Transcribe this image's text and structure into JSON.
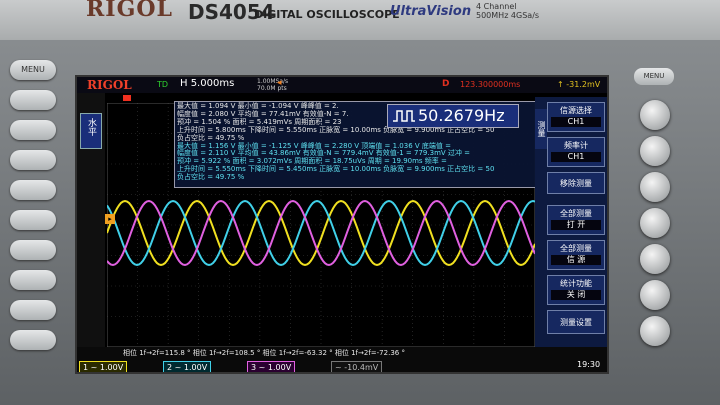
{
  "brand": "RIGOL",
  "model": "DS4054",
  "subtitle": "DIGITAL OSCILLOSCOPE",
  "logo_text": "UltraVision",
  "spec_line1": "4 Channel",
  "spec_line2": "500MHz 4GSa/s",
  "left_button": "MENU",
  "right_button": "MENU",
  "screen": {
    "logo": "RIGOL",
    "status": "TD",
    "timebase": "H  5.000ms",
    "sample_rate": "1.00MSa/s",
    "mem_depth": "70.0M pts",
    "trigger_icon": "trigger-icon",
    "delay_label": "D",
    "delay_value": "123.300000ms",
    "trigger_level": "-31.2mV",
    "h_button": "水平",
    "freq_value": "50.2679Hz",
    "phase_line": "相位 1f→2f=115.8 °     相位 1f→2f=108.5 °     相位 1f→2f=-63.32 °     相位 1f→2f=-72.36 °",
    "ch1": "~ 1.00V",
    "ch2": "~ 1.00V",
    "ch3": "~ 1.00V",
    "ch4": "~ -10.4mV",
    "clock": "19:30"
  },
  "measurements": {
    "rows": [
      "最大值 = 1.094 V    最小值 = -1.094 V    峰峰值 = 2.",
      "幅度值 = 2.080 V    平均值 = 77.41mV    有效值-N = 7.",
      "预冲  = 1.504 %     面积   = 5.419mVs   周期面积 = 23",
      "上升时间 = 5.800ms   下降时间 = 5.550ms   正脉宽 = 10.00ms   负脉宽 = 9.900ms   正占空比 = 50",
      "负占空比 = 49.75 %",
      "最大值 = 1.156 V    最小值 = -1.125 V    峰峰值 = 2.280 V    顶端值 = 1.036 V    底端值 = ",
      "幅度值 = 2.110 V    平均值 = 43.86mV    有效值-N = 779.4mV    有效值-1 = 779.3mV    过冲  = ",
      "预冲  = 5.922 %     面积   = 3.072mVs   周期面积 = 18.75uVs   周期  = 19.90ms    频率   = ",
      "上升时间 = 5.550ms   下降时间 = 5.450ms   正脉宽 = 10.00ms   负脉宽 = 9.900ms   正占空比 = 50",
      "负占空比 = 49.75 %"
    ]
  },
  "menu": {
    "side_tab": "测量",
    "items": [
      {
        "title": "信源选择",
        "value": "CH1"
      },
      {
        "title": "频率计",
        "value": "CH1"
      },
      {
        "title": "移除测量",
        "value": ""
      },
      {
        "title": "全部测量",
        "value": "打 开"
      },
      {
        "title": "全部测量",
        "value": "信 源"
      },
      {
        "title": "统计功能",
        "value": "关 闭"
      },
      {
        "title": "测量设置",
        "value": ""
      }
    ]
  },
  "colors": {
    "ch1": "#f0e020",
    "ch2": "#40d0e8",
    "ch3": "#e060e0"
  }
}
